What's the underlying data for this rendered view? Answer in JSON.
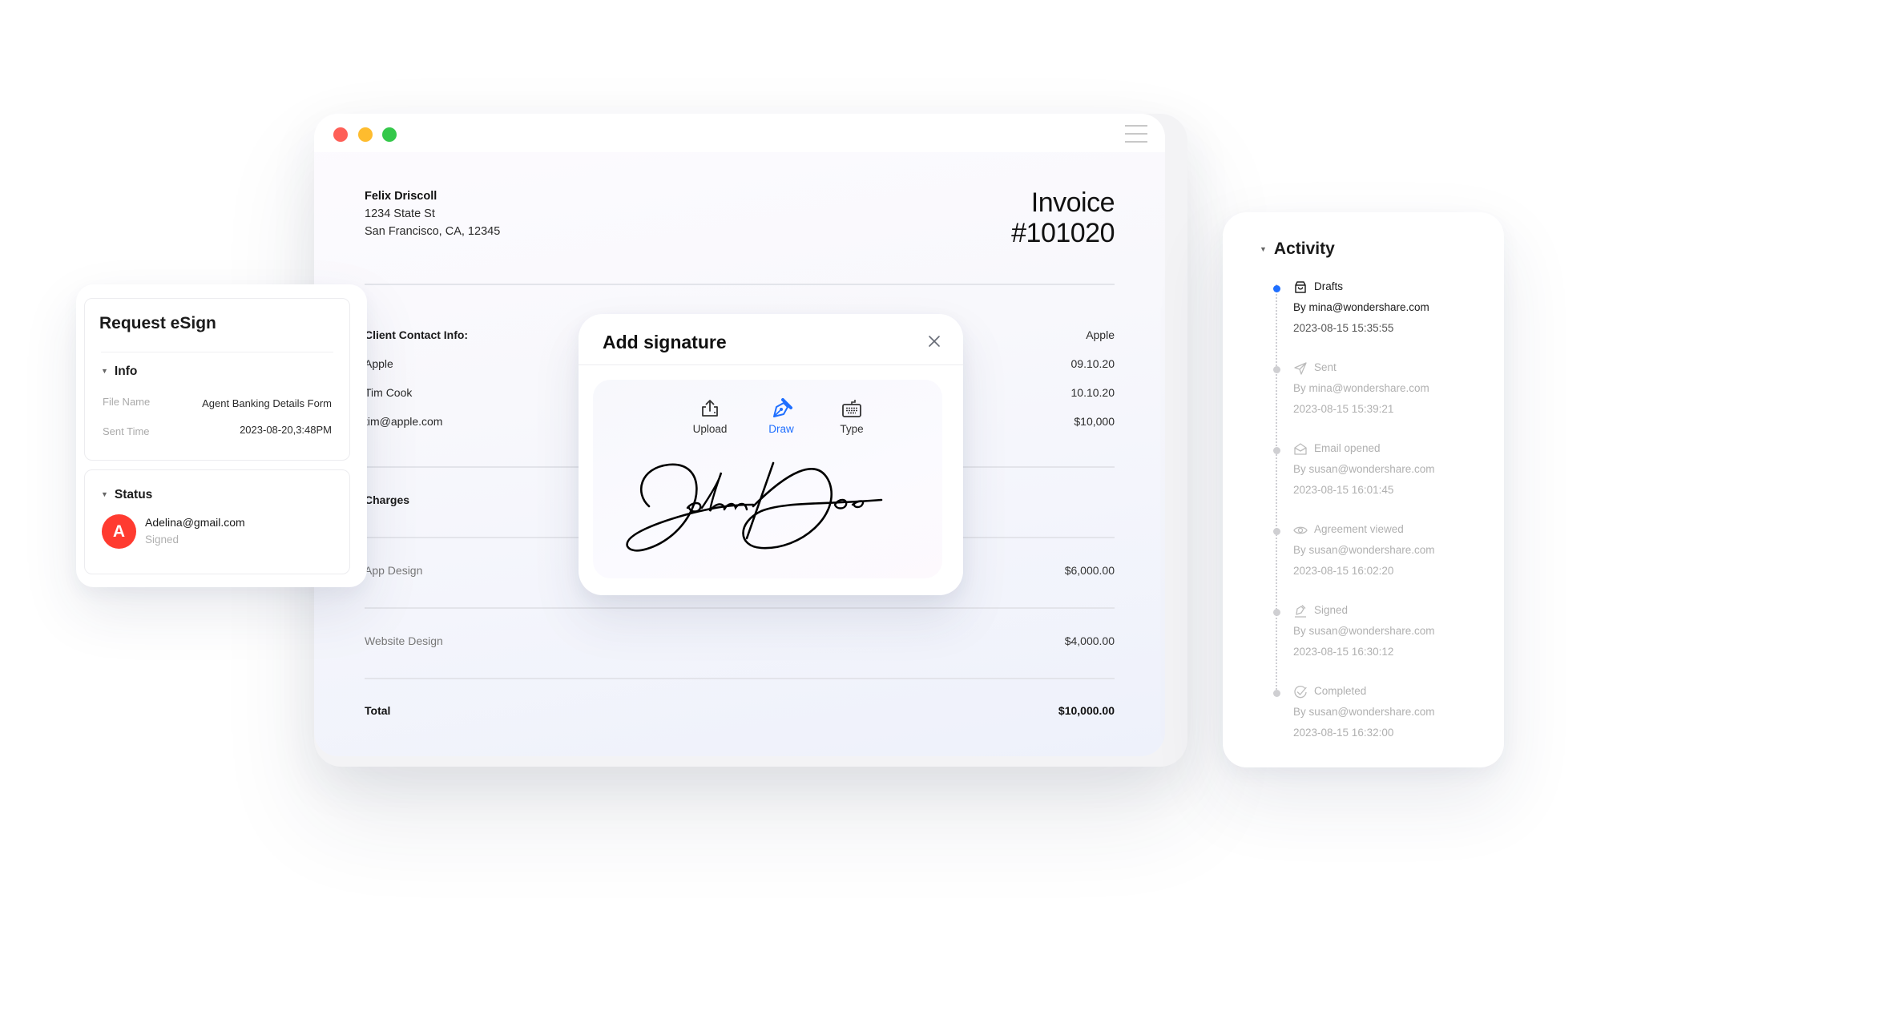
{
  "invoice_window": {
    "menu_icon": "hamburger-icon",
    "sender": {
      "name": "Felix Driscoll",
      "address_line1": "1234 State St",
      "address_line2": "San Francisco, CA, 12345"
    },
    "title_line1": "Invoice",
    "title_line2": "#101020",
    "client": {
      "label": "Client Contact Info:",
      "company": "Apple",
      "contact": "Tim Cook",
      "email": "tim@apple.com"
    },
    "right_column": [
      "Apple",
      "09.10.20",
      "10.10.20",
      "$10,000"
    ],
    "charges_label": "Charges",
    "line_items": [
      {
        "label": "App Design",
        "amount": "$6,000.00"
      },
      {
        "label": "Website Design",
        "amount": "$4,000.00"
      }
    ],
    "total": {
      "label": "Total",
      "amount": "$10,000.00"
    }
  },
  "signature_modal": {
    "title": "Add signature",
    "close_icon": "close-icon",
    "tabs": [
      {
        "label": "Upload",
        "icon": "upload-icon",
        "active": false
      },
      {
        "label": "Draw",
        "icon": "pen-icon",
        "active": true
      },
      {
        "label": "Type",
        "icon": "keyboard-icon",
        "active": false
      }
    ],
    "signature_text": "John Doe",
    "accent_color": "#1f6fff"
  },
  "esign_panel": {
    "title": "Request eSign",
    "info": {
      "heading": "Info",
      "fields": [
        {
          "key": "File Name",
          "value": "Agent Banking Details Form"
        },
        {
          "key": "Sent Time",
          "value": "2023-08-20,3:48PM"
        }
      ]
    },
    "status": {
      "heading": "Status",
      "signer": {
        "initial": "A",
        "email": "Adelina@gmail.com",
        "state": "Signed",
        "avatar_color": "#ff3b30"
      }
    }
  },
  "activity": {
    "title": "Activity",
    "items": [
      {
        "label": "Drafts",
        "icon": "drafts-icon",
        "by": "By mina@wondershare.com",
        "time": "2023-08-15 15:35:55",
        "active": true
      },
      {
        "label": "Sent",
        "icon": "send-icon",
        "by": "By mina@wondershare.com",
        "time": "2023-08-15 15:39:21",
        "active": false
      },
      {
        "label": "Email opened",
        "icon": "envelope-open-icon",
        "by": "By susan@wondershare.com",
        "time": "2023-08-15 16:01:45",
        "active": false
      },
      {
        "label": "Agreement viewed",
        "icon": "eye-icon",
        "by": "By susan@wondershare.com",
        "time": "2023-08-15 16:02:20",
        "active": false
      },
      {
        "label": "Signed",
        "icon": "signed-icon",
        "by": "By susan@wondershare.com",
        "time": "2023-08-15 16:30:12",
        "active": false
      },
      {
        "label": "Completed",
        "icon": "check-circle-icon",
        "by": "By susan@wondershare.com",
        "time": "2023-08-15 16:32:00",
        "active": false
      }
    ]
  }
}
